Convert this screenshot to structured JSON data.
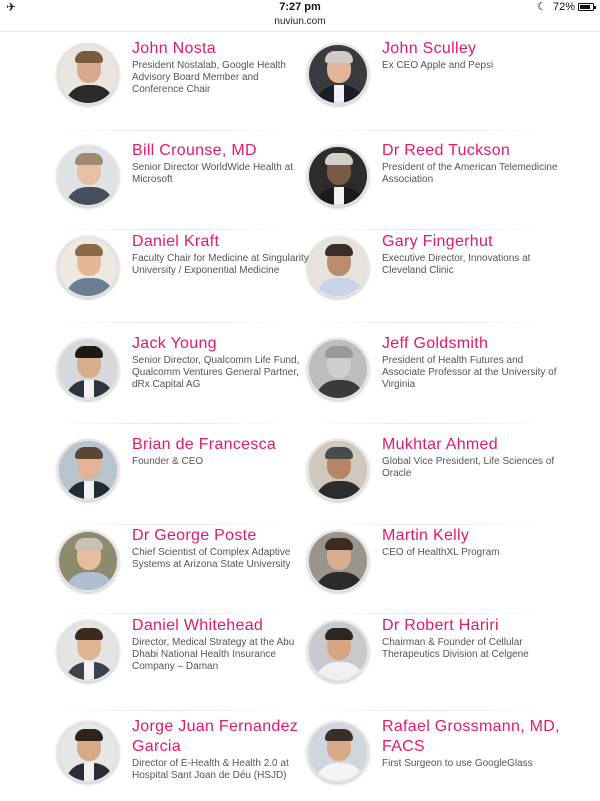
{
  "status_bar": {
    "time": "7:27 pm",
    "battery": "72%"
  },
  "browser": {
    "url": "nuviun.com"
  },
  "people": [
    {
      "name": "John Nosta",
      "title": "President Nostalab, Google Health Advisory Board Member and Conference Chair"
    },
    {
      "name": "John Sculley",
      "title": "Ex CEO Apple and Pepsi"
    },
    {
      "name": "Bill Crounse, MD",
      "title": "Senior Director WorldWide Health at Microsoft"
    },
    {
      "name": "Dr Reed Tuckson",
      "title": "President of the American Telemedicine Association"
    },
    {
      "name": "Daniel Kraft",
      "title": "Faculty Chair for Medicine at Singularity University / Exponential Medicine"
    },
    {
      "name": "Gary Fingerhut",
      "title": "Executive Director, Innovations at Cleveland Clinic"
    },
    {
      "name": "Jack Young",
      "title": "Senior Director, Qualcomm Life Fund, Qualcomm Ventures General Partner, dRx Capital AG"
    },
    {
      "name": "Jeff Goldsmith",
      "title": "President of Health Futures and Associate Professor at the University of Virginia"
    },
    {
      "name": "Brian de Francesca",
      "title": "Founder & CEO"
    },
    {
      "name": "Mukhtar Ahmed",
      "title": "Global Vice President, Life Sciences of Oracle"
    },
    {
      "name": "Dr George Poste",
      "title": "Chief Scientist of Complex Adaptive Systems at Arizona State University"
    },
    {
      "name": "Martin Kelly",
      "title": "CEO of HealthXL Program"
    },
    {
      "name": "Daniel Whitehead",
      "title": "Director, Medical Strategy at the Abu Dhabi National Health Insurance Company – Daman"
    },
    {
      "name": "Dr Robert Hariri",
      "title": "Chairman & Founder of Cellular Therapeutics Division at Celgene"
    },
    {
      "name": "Jorge Juan Fernandez Garcia",
      "title": "Director of E-Health & Health 2.0 at Hospital Sant Joan de Déu (HSJD)"
    },
    {
      "name": "Rafael Grossmann, MD, FACS",
      "title": "First Surgeon to use GoogleGlass"
    }
  ]
}
